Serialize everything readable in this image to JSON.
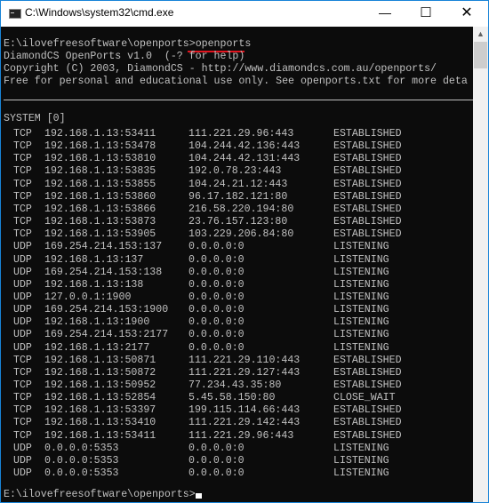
{
  "window": {
    "title": "C:\\Windows\\system32\\cmd.exe",
    "controls": [
      "minimize",
      "maximize",
      "close"
    ]
  },
  "terminal": {
    "prompt_line": {
      "prompt": "E:\\ilovefreesoftware\\openports>",
      "command": "openports"
    },
    "header_lines": [
      "DiamondCS OpenPorts v1.0  (-? for help)",
      "Copyright (C) 2003, DiamondCS - http://www.diamondcs.com.au/openports/",
      "Free for personal and educational use only. See openports.txt for more deta"
    ],
    "process_label": "SYSTEM [0]",
    "rows": [
      [
        "TCP",
        "192.168.1.13:53411",
        "111.221.29.96:443",
        "ESTABLISHED"
      ],
      [
        "TCP",
        "192.168.1.13:53478",
        "104.244.42.136:443",
        "ESTABLISHED"
      ],
      [
        "TCP",
        "192.168.1.13:53810",
        "104.244.42.131:443",
        "ESTABLISHED"
      ],
      [
        "TCP",
        "192.168.1.13:53835",
        "192.0.78.23:443",
        "ESTABLISHED"
      ],
      [
        "TCP",
        "192.168.1.13:53855",
        "104.24.21.12:443",
        "ESTABLISHED"
      ],
      [
        "TCP",
        "192.168.1.13:53860",
        "96.17.182.121:80",
        "ESTABLISHED"
      ],
      [
        "TCP",
        "192.168.1.13:53866",
        "216.58.220.194:80",
        "ESTABLISHED"
      ],
      [
        "TCP",
        "192.168.1.13:53873",
        "23.76.157.123:80",
        "ESTABLISHED"
      ],
      [
        "TCP",
        "192.168.1.13:53905",
        "103.229.206.84:80",
        "ESTABLISHED"
      ],
      [
        "UDP",
        "169.254.214.153:137",
        "0.0.0.0:0",
        "LISTENING"
      ],
      [
        "UDP",
        "192.168.1.13:137",
        "0.0.0.0:0",
        "LISTENING"
      ],
      [
        "UDP",
        "169.254.214.153:138",
        "0.0.0.0:0",
        "LISTENING"
      ],
      [
        "UDP",
        "192.168.1.13:138",
        "0.0.0.0:0",
        "LISTENING"
      ],
      [
        "UDP",
        "127.0.0.1:1900",
        "0.0.0.0:0",
        "LISTENING"
      ],
      [
        "UDP",
        "169.254.214.153:1900",
        "0.0.0.0:0",
        "LISTENING"
      ],
      [
        "UDP",
        "192.168.1.13:1900",
        "0.0.0.0:0",
        "LISTENING"
      ],
      [
        "UDP",
        "169.254.214.153:2177",
        "0.0.0.0:0",
        "LISTENING"
      ],
      [
        "UDP",
        "192.168.1.13:2177",
        "0.0.0.0:0",
        "LISTENING"
      ],
      [
        "TCP",
        "192.168.1.13:50871",
        "111.221.29.110:443",
        "ESTABLISHED"
      ],
      [
        "TCP",
        "192.168.1.13:50872",
        "111.221.29.127:443",
        "ESTABLISHED"
      ],
      [
        "TCP",
        "192.168.1.13:50952",
        "77.234.43.35:80",
        "ESTABLISHED"
      ],
      [
        "TCP",
        "192.168.1.13:52854",
        "5.45.58.150:80",
        "CLOSE_WAIT"
      ],
      [
        "TCP",
        "192.168.1.13:53397",
        "199.115.114.66:443",
        "ESTABLISHED"
      ],
      [
        "TCP",
        "192.168.1.13:53410",
        "111.221.29.142:443",
        "ESTABLISHED"
      ],
      [
        "TCP",
        "192.168.1.13:53411",
        "111.221.29.96:443",
        "ESTABLISHED"
      ],
      [
        "UDP",
        "0.0.0.0:5353",
        "0.0.0.0:0",
        "LISTENING"
      ],
      [
        "UDP",
        "0.0.0.0:5353",
        "0.0.0.0:0",
        "LISTENING"
      ],
      [
        "UDP",
        "0.0.0.0:5353",
        "0.0.0.0:0",
        "LISTENING"
      ]
    ],
    "final_prompt": "E:\\ilovefreesoftware\\openports>",
    "annotation_color": "#e0141e"
  }
}
